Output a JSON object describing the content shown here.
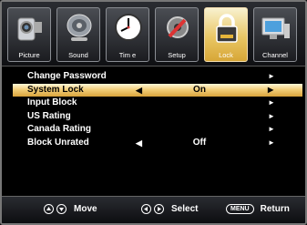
{
  "tabs": [
    {
      "label": "Picture",
      "icon": "camera-icon"
    },
    {
      "label": "Sound",
      "icon": "speaker-icon"
    },
    {
      "label": "Tim e",
      "icon": "clock-icon"
    },
    {
      "label": "Setup",
      "icon": "wrench-icon"
    },
    {
      "label": "Lock",
      "icon": "lock-icon",
      "active": true
    },
    {
      "label": "Channel",
      "icon": "monitor-icon"
    }
  ],
  "menu": [
    {
      "name": "Change Password",
      "value": ""
    },
    {
      "name": "System Lock",
      "value": "On",
      "selected": true
    },
    {
      "name": "Input Block",
      "value": ""
    },
    {
      "name": "US Rating",
      "value": ""
    },
    {
      "name": "Canada Rating",
      "value": ""
    },
    {
      "name": "Block Unrated",
      "value": "Off"
    }
  ],
  "hints": {
    "move": "Move",
    "select": "Select",
    "menu_key": "MENU",
    "return": "Return"
  },
  "colors": {
    "highlight": "#f2cf7a",
    "active_tab": "#e9c765"
  }
}
